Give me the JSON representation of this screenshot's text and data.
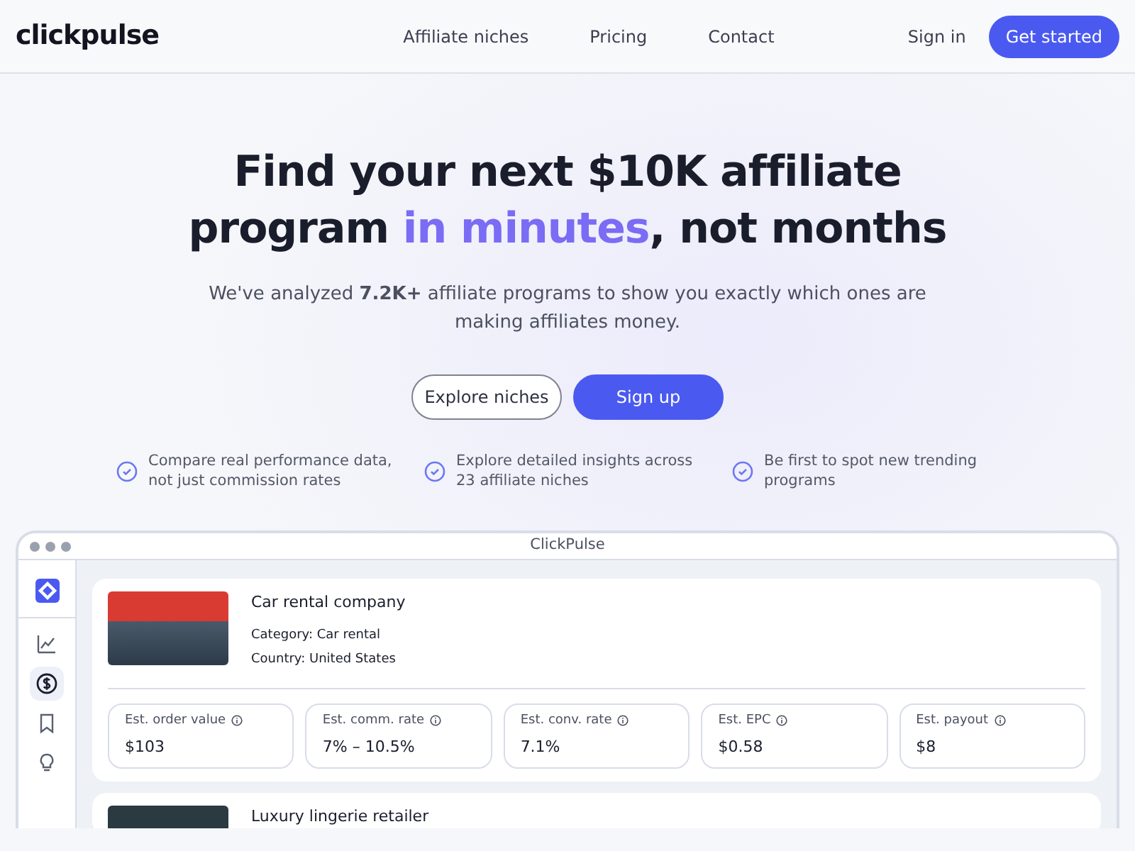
{
  "navbar": {
    "logo": "clickpulse",
    "links": [
      "Affiliate niches",
      "Pricing",
      "Contact"
    ],
    "sign_in": "Sign in",
    "cta": "Get started"
  },
  "hero": {
    "headline_line1": "Find your next $10K affiliate",
    "headline_line2": {
      "before": "program ",
      "highlight": "in minutes",
      "after": ", not months"
    },
    "subtitle": "We've analyzed **7.2K+** affiliate programs to show you exactly which ones are making affiliates money.",
    "buttons": [
      {
        "label": "Explore niches",
        "kind": "outline"
      },
      {
        "label": "Sign up",
        "kind": "primary"
      }
    ],
    "features": [
      "Compare real performance data, not just commission rates",
      "Explore detailed insights across 23 affiliate niches",
      "Be first to spot new trending programs"
    ]
  },
  "app_window": {
    "title": "ClickPulse",
    "sidebar": [
      {
        "kind": "chart",
        "selected": false
      },
      {
        "kind": "dollar",
        "selected": true
      },
      {
        "kind": "bookmark",
        "selected": false
      },
      {
        "kind": "bulb",
        "selected": false
      }
    ],
    "programs": [
      {
        "name": "Car rental company",
        "category_label": "Category:",
        "category": "Car rental",
        "country_label": "Country:",
        "country": "United States",
        "metrics": [
          {
            "label": "Est. order value",
            "value": "$103"
          },
          {
            "label": "Est. comm. rate",
            "value": "7% – 10.5%"
          },
          {
            "label": "Est. conv. rate",
            "value": "7.1%"
          },
          {
            "label": "Est. EPC",
            "value": "$0.58"
          },
          {
            "label": "Est. payout",
            "value": "$8"
          }
        ]
      },
      {
        "name": "Luxury lingerie retailer"
      }
    ]
  }
}
